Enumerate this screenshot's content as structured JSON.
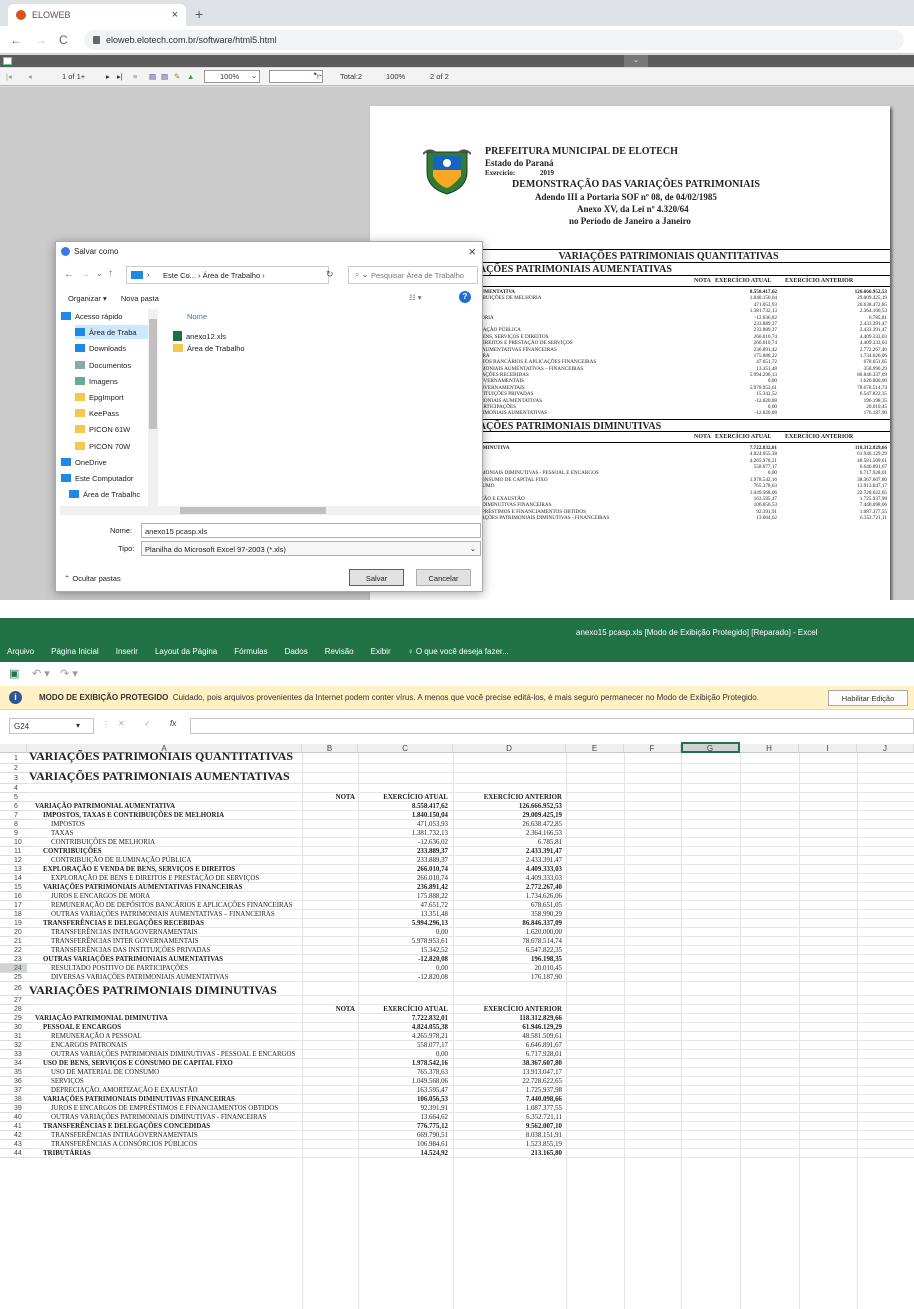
{
  "browser": {
    "tab_title": "ELOWEB",
    "url": "eloweb.elotech.com.br/software/html5.html",
    "toolbar": {
      "page": "1 of 1+",
      "zoom": "100%",
      "total": "Total:2",
      "pct": "100%",
      "of": "2 of 2"
    }
  },
  "pdf": {
    "header": [
      "PREFEITURA MUNICIPAL DE ELOTECH",
      "Estado do Paraná",
      "Exercício:",
      "2019",
      "DEMONSTRAÇÃO DAS VARIAÇÕES PATRIMONIAIS",
      "Adendo III a Portaria SOF nº 08, de 04/02/1985",
      "Anexo XV, da Lei nº 4.320/64",
      "no Período de Janeiro a Janeiro"
    ],
    "table_title": "VARIAÇÕES PATRIMONIAIS QUANTITATIVAS",
    "sec1": "IAÇÕES PATRIMONIAIS AUMENTATIVAS",
    "sec2": "IAÇÕES PATRIMONIAIS DIMINUTIVAS",
    "col_nota": "NOTA",
    "col_atual": "EXERCÍCIO ATUAL",
    "col_anterior": "EXERCÍCIO ANTERIOR",
    "rows1": [
      [
        "RIM ONIAL AUMENTATIVA",
        "8.558.417,62",
        "126.666.952,53"
      ],
      [
        "XAS E CONTRIBUIÇÕES DE MELHORIA",
        "1.840.150,04",
        "29.009.425,19"
      ],
      [
        "",
        "471.053,93",
        "26.638.472,85"
      ],
      [
        "",
        "1.381.732,13",
        "2.364.166,53"
      ],
      [
        "ÕES DE MELHORIA",
        "-12.636,02",
        "6.785,81"
      ],
      [
        "ES",
        "233.889,37",
        "2.433.391,47"
      ],
      [
        "ÃO DE ILUMINAÇÃO PÚBLICA",
        "233.889,37",
        "2.433.391,47"
      ],
      [
        "E VENDA DE BENS, SERVIÇOS E DIREITOS",
        "266.010,74",
        "4.409.333,03"
      ],
      [
        "O DE BENS E DIREITOS E PRESTAÇÃO DE SERVIÇOS",
        "266.010,74",
        "4.409.333,03"
      ],
      [
        "ATRIMONIAIS AUMENTATIVAS FINANCEIRAS",
        "236.891,42",
        "2.772.267,40"
      ],
      [
        "ARGOS DE MORA",
        "175.888,22",
        "1.734.626,06"
      ],
      [
        "ÃO DE DEPÓSITOS BANCÁRIOS E APLICAÇÕES FINANCEIRAS",
        "47.651,72",
        "678.651,05"
      ],
      [
        "IAÇÕES PATRIMONIAIS AUMENTATIVAS – FINANCEIRAS",
        "13.351,48",
        "358.990,29"
      ],
      [
        "CIAS E DELEGAÇÕES RECEBIDAS",
        "5.994.296,13",
        "86.846.337,09"
      ],
      [
        "CIAS INTRAGOVERNAMENTAIS",
        "0,00",
        "1.620.000,00"
      ],
      [
        "CIAS INTER GOVERNAMENTAIS",
        "5.978.953,61",
        "78.678.514,74"
      ],
      [
        "CIAS DAS INSTITUIÇÕES PRIVADAS",
        "15.342,52",
        "6.547.822,35"
      ],
      [
        "AÇÕES PATRIMONIAIS AUMENTATIVAS",
        "-12.820,08",
        "196.198,35"
      ],
      [
        "OSITIVO DE PARTICIPAÇÕES",
        "0,00",
        "20.010,45"
      ],
      [
        "RIAÇÕES PATRIMONIAIS AUMENTATIVAS",
        "-12.820,08",
        "176.187,90"
      ]
    ],
    "rows2": [
      [
        "RIM ONIAL DIMINUTIVA",
        "7.722.832,01",
        "118.312.829,66"
      ],
      [
        "CARGOS",
        "4.824.055,38",
        "61.946.129,29"
      ],
      [
        "ÃO A PESSOAL",
        "4.265.978,21",
        "48.581.509,61"
      ],
      [
        "ATRONAIS",
        "558.077,17",
        "6.646.891,67"
      ],
      [
        "IAÇÕES PATRIMONIAIS DIMINUTIVAS - PESSOAL E ENCARGOS",
        "0,00",
        "6.717.928,01"
      ],
      [
        "SERVIÇOS E CONSUMO DE CAPITAL FIXO",
        "1.978.542,16",
        "38.367.607,80"
      ],
      [
        "RIAL DE CONSUMO",
        "765.378,63",
        "13.913.047,17"
      ],
      [
        "",
        "1.049.568,06",
        "22.728.622,65"
      ],
      [
        "O, AMORTIZAÇÃO E EXAUSTÃO",
        "163.595,47",
        "1.725.937,98"
      ],
      [
        "ATRIMONIAIS DIMINUTIVAS FINANCEIRAS",
        "106.056,53",
        "7.440.098,66"
      ],
      [
        "ARGOS DE EMPRÉSTIMOS E FINANCIAMENTOS OBTIDOS",
        "92.391,91",
        "1.087.377,55"
      ],
      [
        "OUTRAS VARIAÇÕES PATRIMONIAIS DIMINUTIVAS - FINANCEIRAS",
        "13.664,62",
        "6.352.721,11"
      ]
    ]
  },
  "dialog": {
    "title": "Salvar como",
    "path_a": "Este Co...",
    "path_b": "Área de Trabalho",
    "search": "Pesquisar Área de Trabalho",
    "organize": "Organizar ▾",
    "new_folder": "Nova pasta",
    "col_name": "Nome",
    "tree": [
      "Acesso rápido",
      "Área de Traba",
      "Downloads",
      "Documentos",
      "Imagens",
      "EpgImport",
      "KeePass",
      "PICON 61W",
      "PICON 70W",
      "OneDrive",
      "Este Computador",
      "Área de Trabalhc"
    ],
    "files": [
      "anexo12.xls",
      "Área de Trabalho"
    ],
    "name_label": "Nome:",
    "name_value": "anexo15 pcasp.xls",
    "type_label": "Tipo:",
    "type_value": "Planilha do Microsoft Excel 97-2003 (*.xls)",
    "hide": "Ocultar pastas",
    "save": "Salvar",
    "cancel": "Cancelar"
  },
  "excel": {
    "title": "anexo15 pcasp.xls  [Modo de Exibição Protegido] [Reparado] - Excel",
    "tabs": [
      "Arquivo",
      "Página Inicial",
      "Inserir",
      "Layout da Página",
      "Fórmulas",
      "Dados",
      "Revisão",
      "Exibir",
      "♀ O que você deseja fazer..."
    ],
    "prot_title": "MODO DE EXIBIÇÃO PROTEGIDO",
    "prot_msg": "Cuidado, pois arquivos provenientes da Internet podem conter vírus. A menos que você precise editá-los, é mais seguro permanecer no Modo de  Exibição Protegido.",
    "prot_btn": "Habilitar Edição",
    "namebox": "G24",
    "columns": [
      "A",
      "B",
      "C",
      "D",
      "E",
      "F",
      "G",
      "H",
      "I",
      "J"
    ],
    "rows": [
      {
        "a": "VARIAÇÕES PATRIMONIAIS QUANTITATIVAS",
        "s": "big"
      },
      {
        "a": ""
      },
      {
        "a": "VARIAÇÕES PATRIMONIAIS AUMENTATIVAS",
        "s": "big"
      },
      {
        "a": ""
      },
      {
        "b": "NOTA",
        "c": "EXERCÍCIO ATUAL",
        "d": "EXERCÍCIO ANTERIOR",
        "s": "b"
      },
      {
        "a": "VARIAÇÃO  PATRIMONIAL AUMENTATIVA",
        "c": "8.558.417,62",
        "d": "126.666.952,53",
        "s": "b",
        "i": 0
      },
      {
        "a": "IMPOSTOS, TAXAS E CONTRIBUIÇÕES DE MELHORIA",
        "c": "1.840.150,04",
        "d": "29.009.425,19",
        "s": "b",
        "i": 1
      },
      {
        "a": "IMPOSTOS",
        "c": "471.053,93",
        "d": "26.638.472,85",
        "i": 2
      },
      {
        "a": "TAXAS",
        "c": "1.381.732,13",
        "d": "2.364.166,53",
        "i": 2
      },
      {
        "a": "CONTRIBUIÇÕES DE MELHORIA",
        "c": "-12.636,02",
        "d": "6.785,81",
        "i": 2
      },
      {
        "a": "CONTRIBUIÇÕES",
        "c": "233.889,37",
        "d": "2.433.391,47",
        "s": "b",
        "i": 1
      },
      {
        "a": "CONTRIBUIÇÃO DE ILUMINAÇÃO PÚBLICA",
        "c": "233.889,37",
        "d": "2.433.391,47",
        "i": 2
      },
      {
        "a": "EXPLORAÇÃO E VENDA DE BENS, SERVIÇOS E DIREITOS",
        "c": "266.010,74",
        "d": "4.409.333,03",
        "s": "b",
        "i": 1
      },
      {
        "a": "EXPLORAÇÃO DE BENS E DIREITOS E PRESTAÇÃO DE SERVIÇOS",
        "c": "266.010,74",
        "d": "4.409.333,03",
        "i": 2
      },
      {
        "a": "VARIAÇÕES PATRIMONIAIS AUMENTATIVAS FINANCEIRAS",
        "c": "236.891,42",
        "d": "2.772.267,40",
        "s": "b",
        "i": 1
      },
      {
        "a": "JUROS E ENCARGOS DE MORA",
        "c": "175.888,22",
        "d": "1.734.626,06",
        "i": 2
      },
      {
        "a": "REMUNERAÇÃO DE DEPÓSITOS BANCÁRIOS E APLICAÇÕES FINANCEIRAS",
        "c": "47.651,72",
        "d": "678.651,05",
        "i": 2
      },
      {
        "a": "OUTRAS VARIAÇÕES PATRIMONIAIS AUMENTATIVAS – FINANCEIRAS",
        "c": "13.351,48",
        "d": "358.990,29",
        "i": 2
      },
      {
        "a": "TRANSFERÊNCIAS E DELEGAÇÕES RECEBIDAS",
        "c": "5.994.296,13",
        "d": "86.846.337,09",
        "s": "b",
        "i": 1
      },
      {
        "a": "TRANSFERÊNCIAS INTRAGOVERNAMENTAIS",
        "c": "0,00",
        "d": "1.620.000,00",
        "i": 2
      },
      {
        "a": "TRANSFERÊNCIAS INTER GOVERNAMENTAIS",
        "c": "5.978.953,61",
        "d": "78.678.514,74",
        "i": 2
      },
      {
        "a": "TRANSFERÊNCIAS DAS INSTITUIÇÕES PRIVADAS",
        "c": "15.342,52",
        "d": "6.547.822,35",
        "i": 2
      },
      {
        "a": "OUTRAS VARIAÇÕES PATRIMONIAIS AUMENTATIVAS",
        "c": "-12.820,08",
        "d": "196.198,35",
        "s": "b",
        "i": 1
      },
      {
        "a": "RESULTADO POSITIVO DE PARTICIPAÇÕES",
        "c": "0,00",
        "d": "20.010,45",
        "i": 2
      },
      {
        "a": "DIVERSAS VARIAÇÕES PATRIMONIAIS AUMENTATIVAS",
        "c": "-12.820,08",
        "d": "176.187,90",
        "i": 2
      },
      {
        "a": "VARIAÇÕES PATRIMONIAIS DIMINUTIVAS",
        "s": "big"
      },
      {
        "a": ""
      },
      {
        "b": "NOTA",
        "c": "EXERCÍCIO ATUAL",
        "d": "EXERCÍCIO ANTERIOR",
        "s": "b"
      },
      {
        "a": "VARIAÇÃO  PATRIMONIAL DIMINUTIVA",
        "c": "7.722.832,01",
        "d": "118.312.829,66",
        "s": "b",
        "i": 0
      },
      {
        "a": "PESSOAL E ENCARGOS",
        "c": "4.824.055,38",
        "d": "61.946.129,29",
        "s": "b",
        "i": 1
      },
      {
        "a": "REMUNERAÇÃO A PESSOAL",
        "c": "4.265.978,21",
        "d": "48.581.509,61",
        "i": 2
      },
      {
        "a": "ENCARGOS PATRONAIS",
        "c": "558.077,17",
        "d": "6.646.891,67",
        "i": 2
      },
      {
        "a": "OUTRAS VARIAÇÕES PATRIMONIAIS DIMINUTIVAS - PESSOAL E ENCARGOS",
        "c": "0,00",
        "d": "6.717.928,01",
        "i": 2
      },
      {
        "a": "USO DE BENS, SERVIÇOS E CONSUMO DE CAPITAL FIXO",
        "c": "1.978.542,16",
        "d": "38.367.607,80",
        "s": "b",
        "i": 1
      },
      {
        "a": "USO DE MATERIAL DE CONSUMO",
        "c": "765.378,63",
        "d": "13.913.047,17",
        "i": 2
      },
      {
        "a": "SERVIÇOS",
        "c": "1.049.568,06",
        "d": "22.728.622,65",
        "i": 2
      },
      {
        "a": "DEPRECIAÇÃO, AMORTIZAÇÃO E EXAUSTÃO",
        "c": "163.595,47",
        "d": "1.725.937,98",
        "i": 2
      },
      {
        "a": "VARIAÇÕES PATRIMONIAIS DIMINUTIVAS FINANCEIRAS",
        "c": "106.056,53",
        "d": "7.440.098,66",
        "s": "b",
        "i": 1
      },
      {
        "a": "JUROS E ENCARGOS DE EMPRÉSTIMOS E FINANCIAMENTOS OBTIDOS",
        "c": "92.391,91",
        "d": "1.087.377,55",
        "i": 2
      },
      {
        "a": "OUTRAS VARIAÇÕES PATRIMONIAIS DIMINUTIVAS - FINANCEIRAS",
        "c": "13.664,62",
        "d": "6.352.721,11",
        "i": 2
      },
      {
        "a": "TRANSFERÊNCIAS E DELEGAÇÕES CONCEDIDAS",
        "c": "776.775,12",
        "d": "9.562.007,10",
        "s": "b",
        "i": 1
      },
      {
        "a": "TRANSFERÊNCIAS INTRAGOVERNAMENTAIS",
        "c": "669.790,51",
        "d": "8.038.151,91",
        "i": 2
      },
      {
        "a": "TRANSFERÊNCIAS A CONSÓRCIOS PÚBLICOS",
        "c": "106.984,61",
        "d": "1.523.855,19",
        "i": 2
      },
      {
        "a": "TRIBUTÁRIAS",
        "c": "14.524,92",
        "d": "213.165,80",
        "s": "b",
        "i": 1
      }
    ]
  }
}
